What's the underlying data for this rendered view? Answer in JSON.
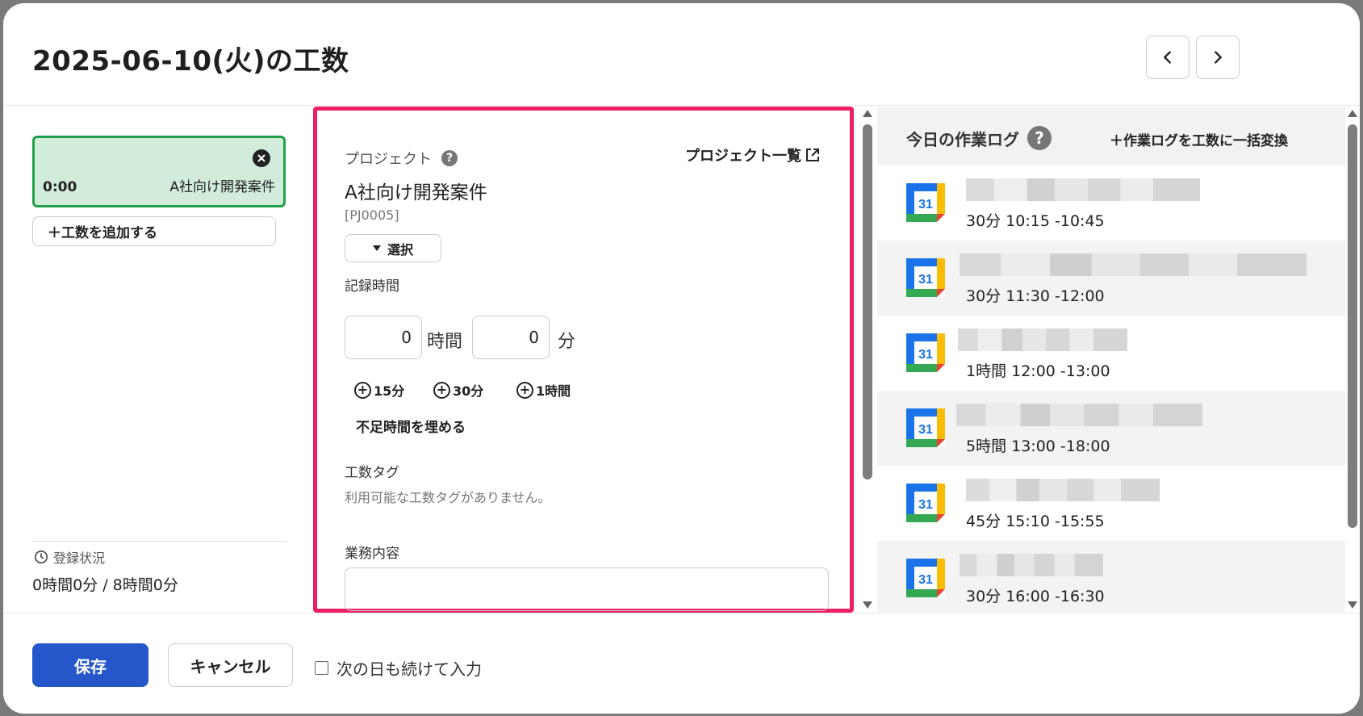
{
  "title": "2025-06-10(火)の工数",
  "entry": {
    "time": "0:00",
    "project": "A社向け開発案件"
  },
  "add_button_label": "＋工数を追加する",
  "status": {
    "label": "登録状況",
    "value": "0時間0分 / 8時間0分"
  },
  "project": {
    "label": "プロジェクト",
    "help": "?",
    "list_link": "プロジェクト一覧",
    "name": "A社向け開発案件",
    "code": "[PJ0005]",
    "select_label": "選択"
  },
  "record_time": {
    "label": "記録時間",
    "hours_value": "0",
    "hours_unit": "時間",
    "minutes_value": "0",
    "minutes_unit": "分",
    "quick_add": [
      "15分",
      "30分",
      "1時間"
    ],
    "fill_label": "不足時間を埋める"
  },
  "tags": {
    "label": "工数タグ",
    "empty": "利用可能な工数タグがありません。"
  },
  "task": {
    "label": "業務内容",
    "value": ""
  },
  "work_log": {
    "title": "今日の作業ログ",
    "help": "?",
    "convert_label": "＋作業ログを工数に一括変換",
    "items": [
      {
        "time": "30分  10:15 -10:45"
      },
      {
        "time": "30分  11:30 -12:00"
      },
      {
        "time": "1時間  12:00 -13:00"
      },
      {
        "time": "5時間  13:00 -18:00"
      },
      {
        "time": "45分  15:10 -15:55"
      },
      {
        "time": "30分  16:00 -16:30"
      }
    ],
    "calendar_icon_text": "31"
  },
  "footer": {
    "save_label": "保存",
    "cancel_label": "キャンセル",
    "continue_label": "次の日も続けて入力"
  },
  "colors": {
    "accent": "#2557cb",
    "highlight_border": "#ee1f62",
    "entry_bg": "#d2ecdc",
    "entry_border": "#21a04b"
  }
}
